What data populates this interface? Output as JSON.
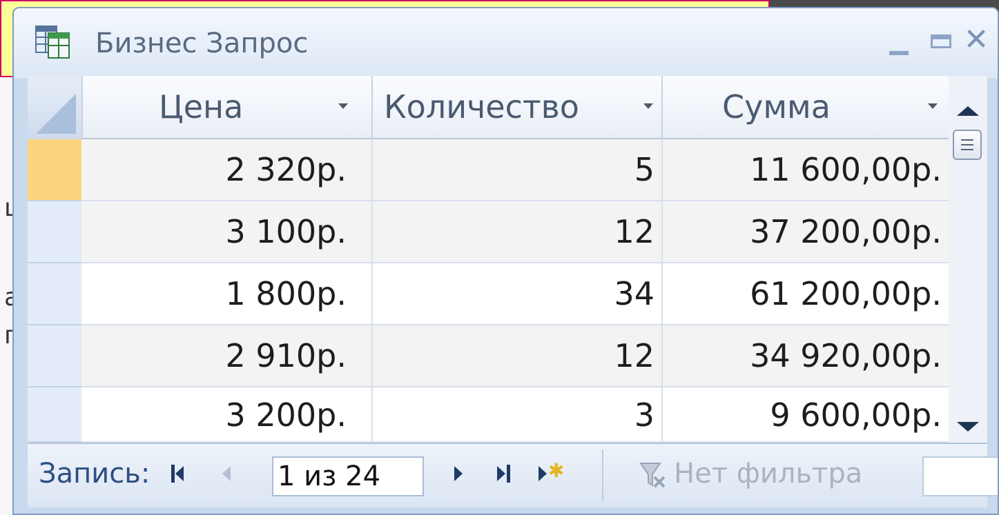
{
  "window": {
    "title": "Бизнес Запрос"
  },
  "columns": [
    {
      "label": "Цена"
    },
    {
      "label": "Количество"
    },
    {
      "label": "Сумма"
    }
  ],
  "rows": [
    {
      "price": "2 320р.",
      "qty": "5",
      "sum": "11 600,00р."
    },
    {
      "price": "3 100р.",
      "qty": "12",
      "sum": "37 200,00р."
    },
    {
      "price": "1 800р.",
      "qty": "34",
      "sum": "61 200,00р."
    },
    {
      "price": "2 910р.",
      "qty": "12",
      "sum": "34 920,00р."
    },
    {
      "price": "3 200р.",
      "qty": "3",
      "sum": "9 600,00р."
    }
  ],
  "navigation": {
    "record_label": "Запись:",
    "record_position": "1 из 24",
    "filter_label": "Нет фильтра"
  },
  "colors": {
    "selected_row": "#fcd47f",
    "header": "#e9eef6",
    "title_text": "#5b6a80",
    "nav_text": "#2c4f83"
  }
}
